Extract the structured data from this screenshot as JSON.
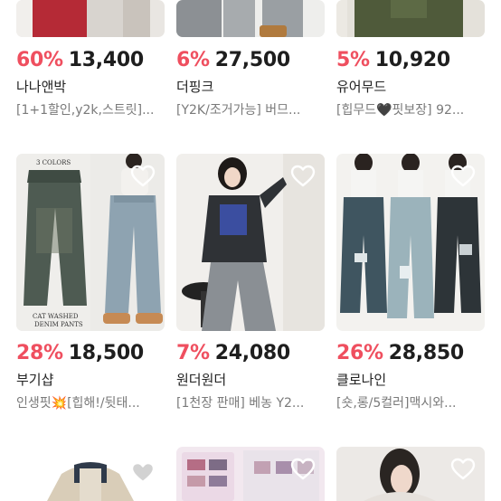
{
  "colors": {
    "discount": "#ef4f5f",
    "price": "#1e1e1e",
    "shop": "#222222",
    "desc": "#7a7a7a"
  },
  "products": [
    {
      "discount": "60%",
      "price": "13,400",
      "shop": "나나앤박",
      "desc": "[1+1할인,y2k,스트릿]...",
      "liked": false
    },
    {
      "discount": "6%",
      "price": "27,500",
      "shop": "더핑크",
      "desc": "[Y2K/조거가능] 버므...",
      "liked": false
    },
    {
      "discount": "5%",
      "price": "10,920",
      "shop": "유어무드",
      "desc": "[힙무드🖤핏보장] 92...",
      "liked": false
    },
    {
      "discount": "28%",
      "price": "18,500",
      "shop": "부기샵",
      "desc": "인생핏💥[힙해!/뒷태...",
      "liked": false,
      "image_text": [
        "3 COLORS",
        "CAT WASHED",
        "DENIM PANTS"
      ]
    },
    {
      "discount": "7%",
      "price": "24,080",
      "shop": "원더원더",
      "desc": "[1천장 판매] 베농 Y2...",
      "liked": false
    },
    {
      "discount": "26%",
      "price": "28,850",
      "shop": "클로나인",
      "desc": "[숏,롱/5컬러]맥시와...",
      "liked": false
    }
  ]
}
